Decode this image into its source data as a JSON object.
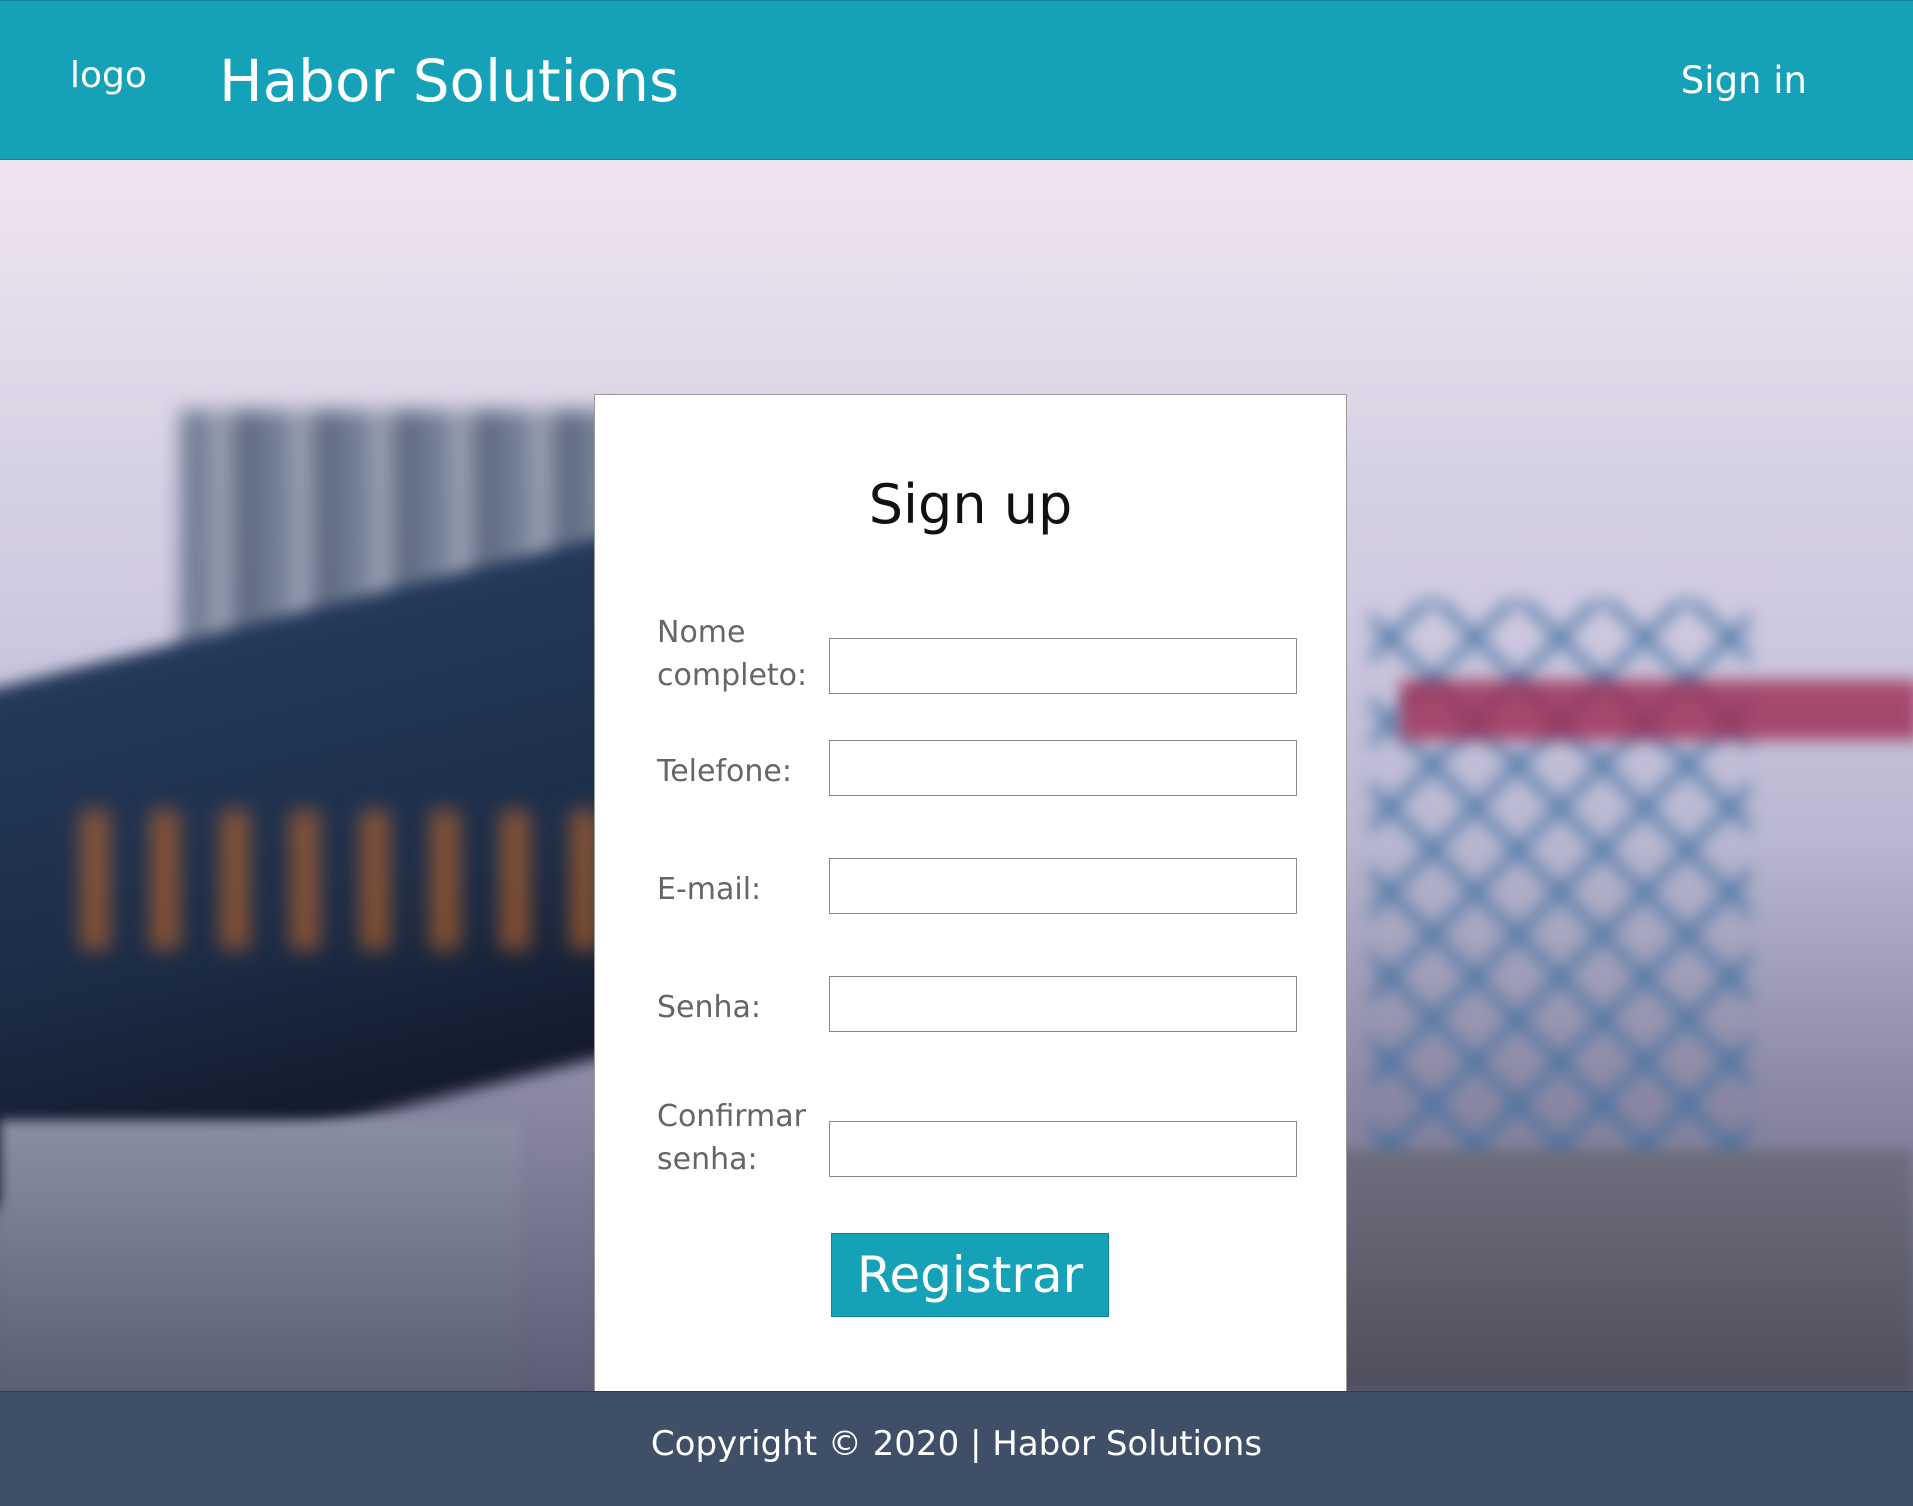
{
  "header": {
    "logo": "logo",
    "brand": "Habor Solutions",
    "signin": "Sign in"
  },
  "form": {
    "title": "Sign up",
    "fields": [
      {
        "label": "Nome completo:",
        "value": ""
      },
      {
        "label": "Telefone:",
        "value": ""
      },
      {
        "label": "E-mail:",
        "value": ""
      },
      {
        "label": "Senha:",
        "value": ""
      },
      {
        "label": "Confirmar senha:",
        "value": ""
      }
    ],
    "submit": "Registrar"
  },
  "footer": {
    "text": "Copyright © 2020 | Habor Solutions"
  },
  "colors": {
    "accent": "#15a2b9",
    "footer": "#3f4f68"
  }
}
